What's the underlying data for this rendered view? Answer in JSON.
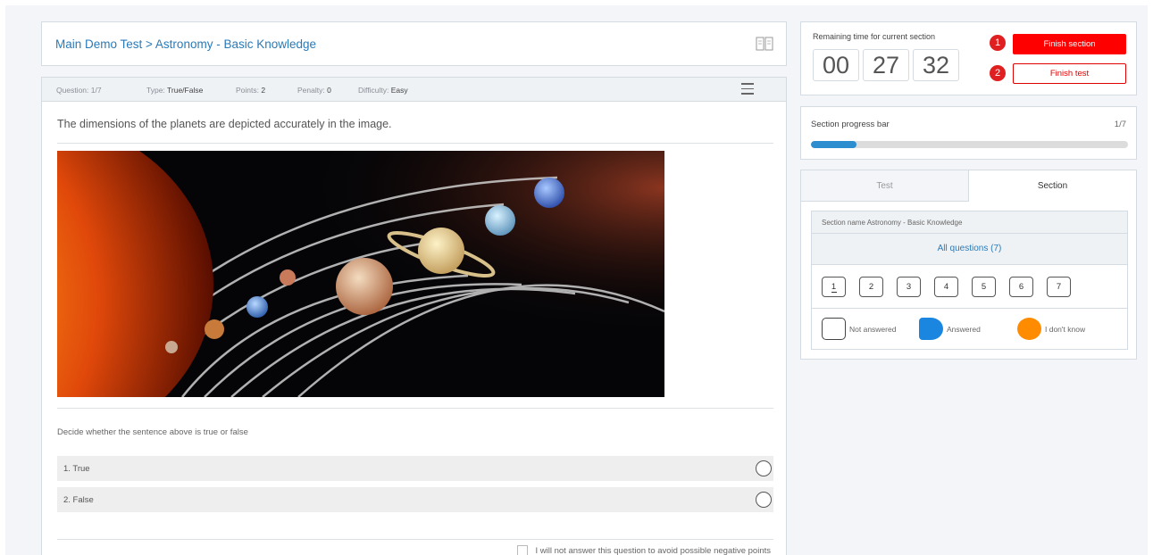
{
  "header": {
    "breadcrumb": "Main Demo Test > Astronomy - Basic Knowledge",
    "icon": "book-icon"
  },
  "question_meta": {
    "question_label": "Question:",
    "question_value": "1/7",
    "type_label": "Type:",
    "type_value": "True/False",
    "points_label": "Points:",
    "points_value": "2",
    "penalty_label": "Penalty:",
    "penalty_value": "0",
    "difficulty_label": "Difficulty:",
    "difficulty_value": "Easy",
    "menu_icon": "hamburger-menu-icon"
  },
  "question": {
    "text": "The dimensions of the planets are depicted accurately in the image.",
    "image": "solar-system-illustration",
    "instruction": "Decide whether the sentence above is true or false",
    "options": [
      {
        "label": "1. True"
      },
      {
        "label": "2. False"
      }
    ],
    "skip_label": "I will not answer this question to avoid possible negative points"
  },
  "timer": {
    "label": "Remaining time for current section",
    "hours": "00",
    "minutes": "27",
    "seconds": "32"
  },
  "actions": {
    "badge_1": "1",
    "badge_2": "2",
    "finish_section": "Finish section",
    "finish_test": "Finish test"
  },
  "progress": {
    "label": "Section progress bar",
    "count": "1/7",
    "fraction": 0.143
  },
  "navigator": {
    "tabs": [
      {
        "label": "Test"
      },
      {
        "label": "Section"
      }
    ],
    "active_tab": "Section",
    "section_name": "Section name Astronomy - Basic Knowledge",
    "all_questions": "All questions (7)",
    "questions": [
      "1",
      "2",
      "3",
      "4",
      "5",
      "6",
      "7"
    ],
    "current_question": "1",
    "legend": {
      "not_answered": "Not answered",
      "answered": "Answered",
      "dont_know": "I don't know"
    }
  },
  "colors": {
    "accent": "#2a7ab8",
    "finish_red": "#ff0000",
    "progress_blue": "#2d8ecf",
    "answered_blue": "#1a86e0",
    "dont_know_orange": "#ff8c00"
  }
}
